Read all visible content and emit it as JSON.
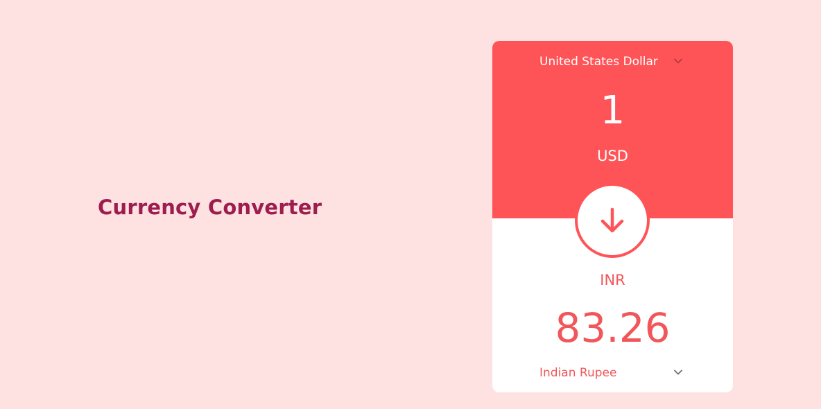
{
  "app": {
    "title": "Currency Converter"
  },
  "converter": {
    "from": {
      "currency_name": "United States Dollar",
      "amount": "1",
      "code": "USD"
    },
    "to": {
      "currency_name": "Indian Rupee",
      "amount": "83.26",
      "code": "INR"
    },
    "swap_icon": "arrow-down-icon",
    "dropdown_icon": "chevron-down-icon"
  },
  "colors": {
    "page_background": "#FEE2E2",
    "accent": "#FF5457",
    "title": "#9D1D4F",
    "card_background": "#FFFFFF"
  }
}
